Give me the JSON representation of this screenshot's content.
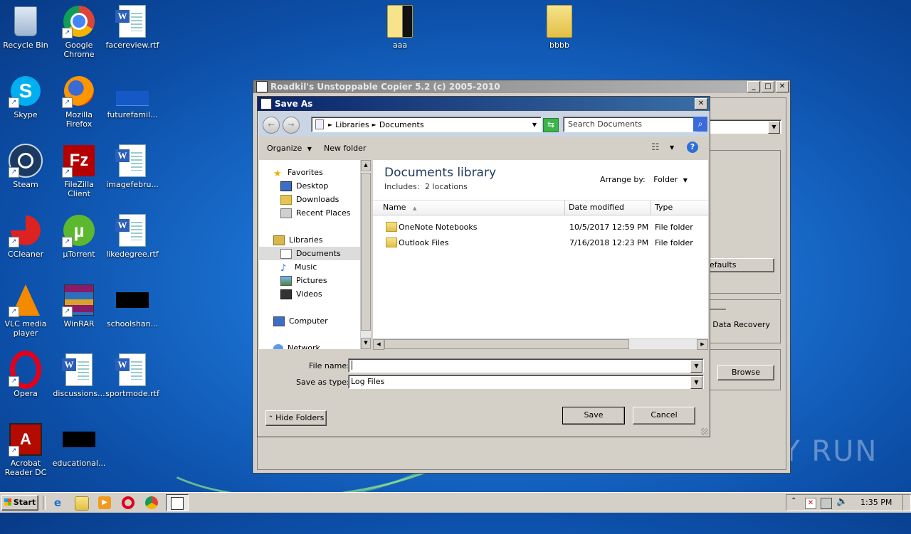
{
  "desktop": {
    "icons": [
      {
        "label": "Recycle Bin"
      },
      {
        "label": "Google Chrome"
      },
      {
        "label": "facereview.rtf"
      },
      {
        "label": "Skype"
      },
      {
        "label": "Mozilla Firefox"
      },
      {
        "label": "futurefamil..."
      },
      {
        "label": "Steam"
      },
      {
        "label": "FileZilla Client"
      },
      {
        "label": "imagefebru..."
      },
      {
        "label": "CCleaner"
      },
      {
        "label": "µTorrent"
      },
      {
        "label": "likedegree.rtf"
      },
      {
        "label": "VLC media player"
      },
      {
        "label": "WinRAR"
      },
      {
        "label": "schoolshan..."
      },
      {
        "label": "Opera"
      },
      {
        "label": "discussions..."
      },
      {
        "label": "sportmode.rtf"
      },
      {
        "label": "Acrobat Reader DC"
      },
      {
        "label": "educational..."
      },
      {
        "label": "aaa"
      },
      {
        "label": "bbbb"
      }
    ]
  },
  "copier": {
    "title": "Roadkil's Unstoppable Copier 5.2 (c) 2005-2010",
    "defaults_label": "efaults",
    "data_recovery_label": ": Data Recovery",
    "browse_label": "Browse"
  },
  "dialog": {
    "title": "Save As",
    "breadcrumb": {
      "part1": "Libraries",
      "part2": "Documents"
    },
    "search_placeholder": "Search Documents",
    "organize": "Organize",
    "new_folder": "New folder",
    "library_title": "Documents library",
    "includes_label": "Includes:",
    "includes_link": "2 locations",
    "arrange_label": "Arrange by:",
    "arrange_value": "Folder",
    "columns": {
      "name": "Name",
      "date": "Date modified",
      "type": "Type"
    },
    "files": [
      {
        "name": "OneNote Notebooks",
        "date": "10/5/2017 12:59 PM",
        "type": "File folder"
      },
      {
        "name": "Outlook Files",
        "date": "7/16/2018 12:23 PM",
        "type": "File folder"
      }
    ],
    "nav": {
      "favorites": "Favorites",
      "desktop": "Desktop",
      "downloads": "Downloads",
      "recent": "Recent Places",
      "libraries": "Libraries",
      "documents": "Documents",
      "music": "Music",
      "pictures": "Pictures",
      "videos": "Videos",
      "computer": "Computer",
      "network": "Network"
    },
    "file_name_label": "File name:",
    "file_name_value": "",
    "save_type_label": "Save as type:",
    "save_type_value": "Log Files",
    "hide_folders": "Hide Folders",
    "save": "Save",
    "cancel": "Cancel"
  },
  "taskbar": {
    "start": "Start",
    "clock": "1:35 PM"
  },
  "watermark": "ANY RUN"
}
